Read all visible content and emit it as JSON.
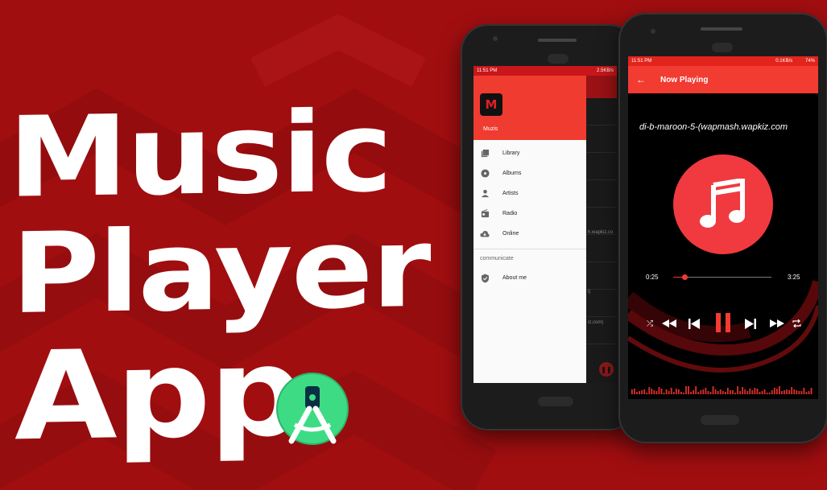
{
  "poster": {
    "title_words": [
      "Music",
      "Player",
      "App"
    ]
  },
  "left_phone": {
    "status": {
      "time": "11:51 PM",
      "speed": "2.5KB/s"
    },
    "app_icon_letter": "M",
    "app_name": "Muzis",
    "menu": [
      {
        "label": "Library",
        "icon": "library-music-icon"
      },
      {
        "label": "Albums",
        "icon": "album-icon"
      },
      {
        "label": "Artists",
        "icon": "person-icon"
      },
      {
        "label": "Radio",
        "icon": "radio-icon"
      },
      {
        "label": "Online",
        "icon": "cloud-download-icon"
      }
    ],
    "section_title": "communicate",
    "about": {
      "label": "About me",
      "icon": "shield-icon"
    },
    "behind_texts": [
      "h.wapkiz.co",
      "l)",
      "iz.com)"
    ]
  },
  "right_phone": {
    "status": {
      "time": "11:51 PM",
      "speed": "0.1KB/s",
      "battery": "74%"
    },
    "toolbar_title": "Now Playing",
    "song_title": "di-b-maroon-5-(wapmash.wapkiz.com",
    "elapsed": "0:25",
    "duration": "3:25",
    "progress_fraction": 0.12,
    "controls": [
      "shuffle-icon",
      "rewind-icon",
      "skip-previous-icon",
      "pause-icon",
      "skip-next-icon",
      "fast-forward-icon",
      "repeat-icon"
    ]
  },
  "colors": {
    "background": "#a10e10",
    "accent": "#f23b31",
    "album_art": "#f03a3f"
  }
}
